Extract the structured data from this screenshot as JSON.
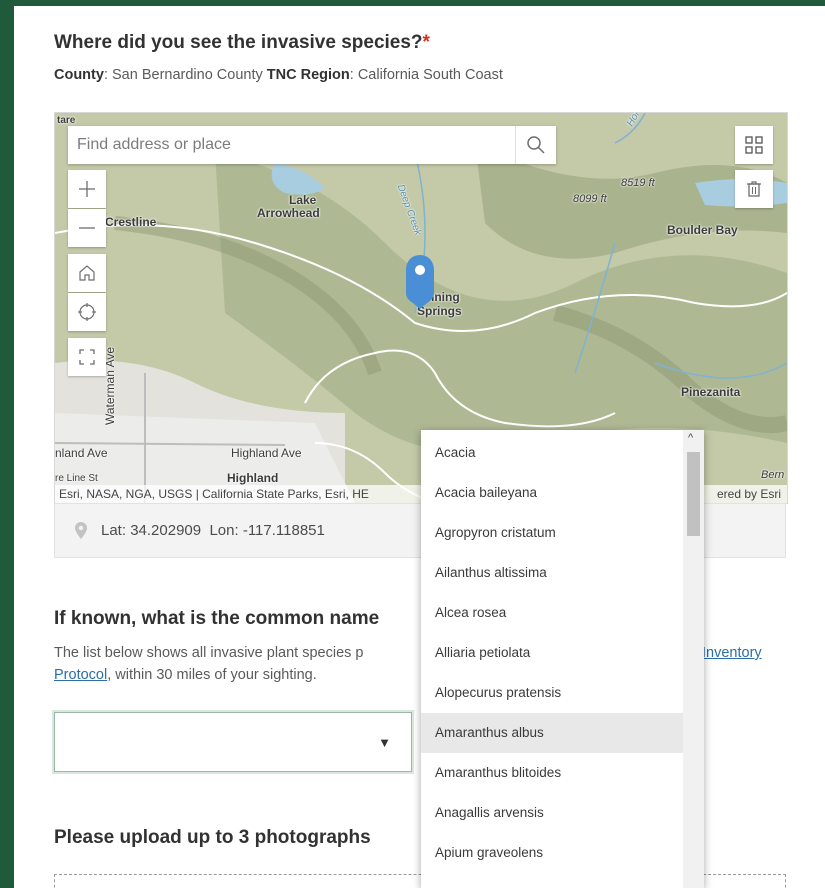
{
  "question1": {
    "title": "Where did you see the invasive species?",
    "required_mark": "*",
    "county_label": "County",
    "county_value": "San Bernardino County",
    "region_label": "TNC Region",
    "region_value": "California South Coast"
  },
  "map": {
    "search_placeholder": "Find address or place",
    "labels": {
      "lake": "Lake",
      "arrowhead": "Arrowhead",
      "crestline": "Crestline",
      "boulder_bay": "Boulder Bay",
      "nning": "nning",
      "springs": "Springs",
      "pinezanita": "Pinezanita",
      "highland_ave": "Highland Ave",
      "land_ave": "nland Ave",
      "waterman_ave": "Waterman Ave",
      "elev1": "8519 ft",
      "elev2": "8099 ft",
      "highland": "Highland",
      "tare": "tare",
      "re_line": "re Line St",
      "bern": "Bern",
      "deep_creek": "Deep Creek",
      "holcomb": "Hol"
    },
    "attribution": "Esri, NASA, NGA, USGS | California State Parks, Esri, HE",
    "powered_by": "ered by Esri"
  },
  "location": {
    "lat_label": "Lat:",
    "lat": "34.202909",
    "lon_label": "Lon:",
    "lon": "-117.118851"
  },
  "question2": {
    "title": "If known, what is the common name",
    "help_line1": "The list below shows all invasive plant species p",
    "help_link_right": "Inventory",
    "help_link": "Protocol",
    "help_line2": ", within 30 miles of your sighting."
  },
  "question3": {
    "title": "Please upload up to 3 photographs"
  },
  "dropdown": {
    "options": [
      "Acacia",
      "Acacia baileyana",
      "Agropyron cristatum",
      "Ailanthus altissima",
      "Alcea rosea",
      "Alliaria petiolata",
      "Alopecurus pratensis",
      "Amaranthus albus",
      "Amaranthus blitoides",
      "Anagallis arvensis",
      "Apium graveolens"
    ],
    "highlighted": "Amaranthus albus"
  },
  "colors": {
    "frame_green": "#1f5b3a",
    "required_red": "#d83020",
    "link_blue": "#2b6ea8",
    "pin_blue": "#4a8fd6"
  }
}
